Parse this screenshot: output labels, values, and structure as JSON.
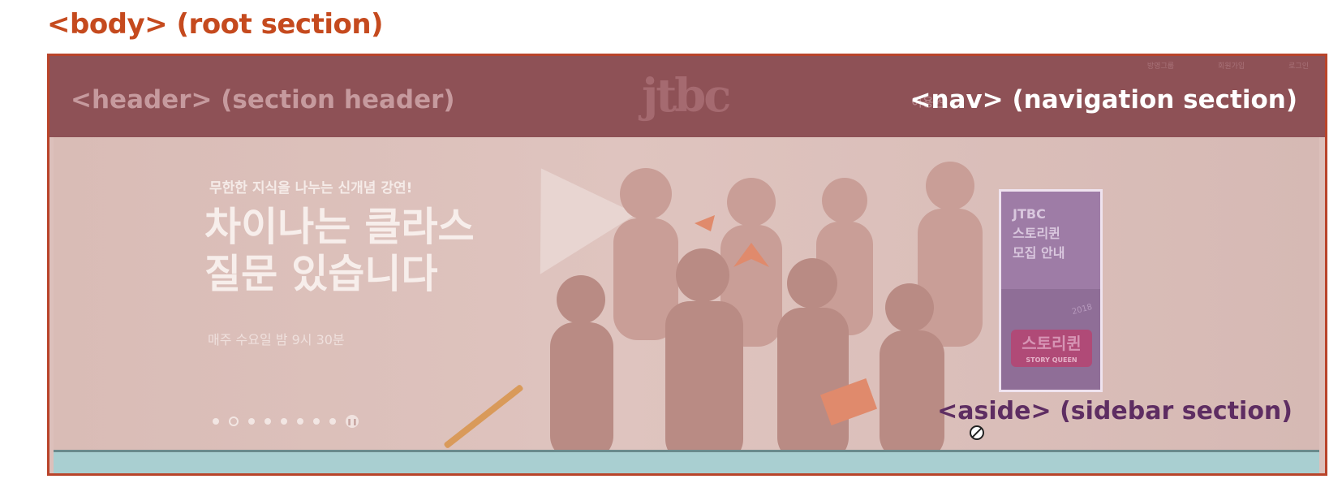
{
  "labels": {
    "body": "<body> (root section)",
    "header": "<header> (section header)",
    "nav": "<nav> (navigation section)",
    "aside": "<aside> (sidebar section)"
  },
  "header": {
    "logo": "jtbc",
    "util_links": [
      "방영그룹",
      "회원가입",
      "로그인"
    ],
    "nav_user": "이용권"
  },
  "hero": {
    "subtitle": "무한한 지식을 나누는 신개념 강연!",
    "title_line1": "차이나는 클라스",
    "title_line2": "질문 있습니다",
    "airtime": "매주 수요일 밤 9시 30분",
    "slide_count": 8,
    "active_slide": 2
  },
  "aside": {
    "banner_text": "JTBC\n스토리퀸\n모집 안내",
    "year": "2018",
    "logo_text": "스토리퀸",
    "logo_sub": "STORY QUEEN"
  },
  "colors": {
    "label_body": "#c54a1e",
    "header_band": "#8e5156",
    "aside_label": "#5e2d62",
    "bottom_strip": "#a9cfd1"
  }
}
